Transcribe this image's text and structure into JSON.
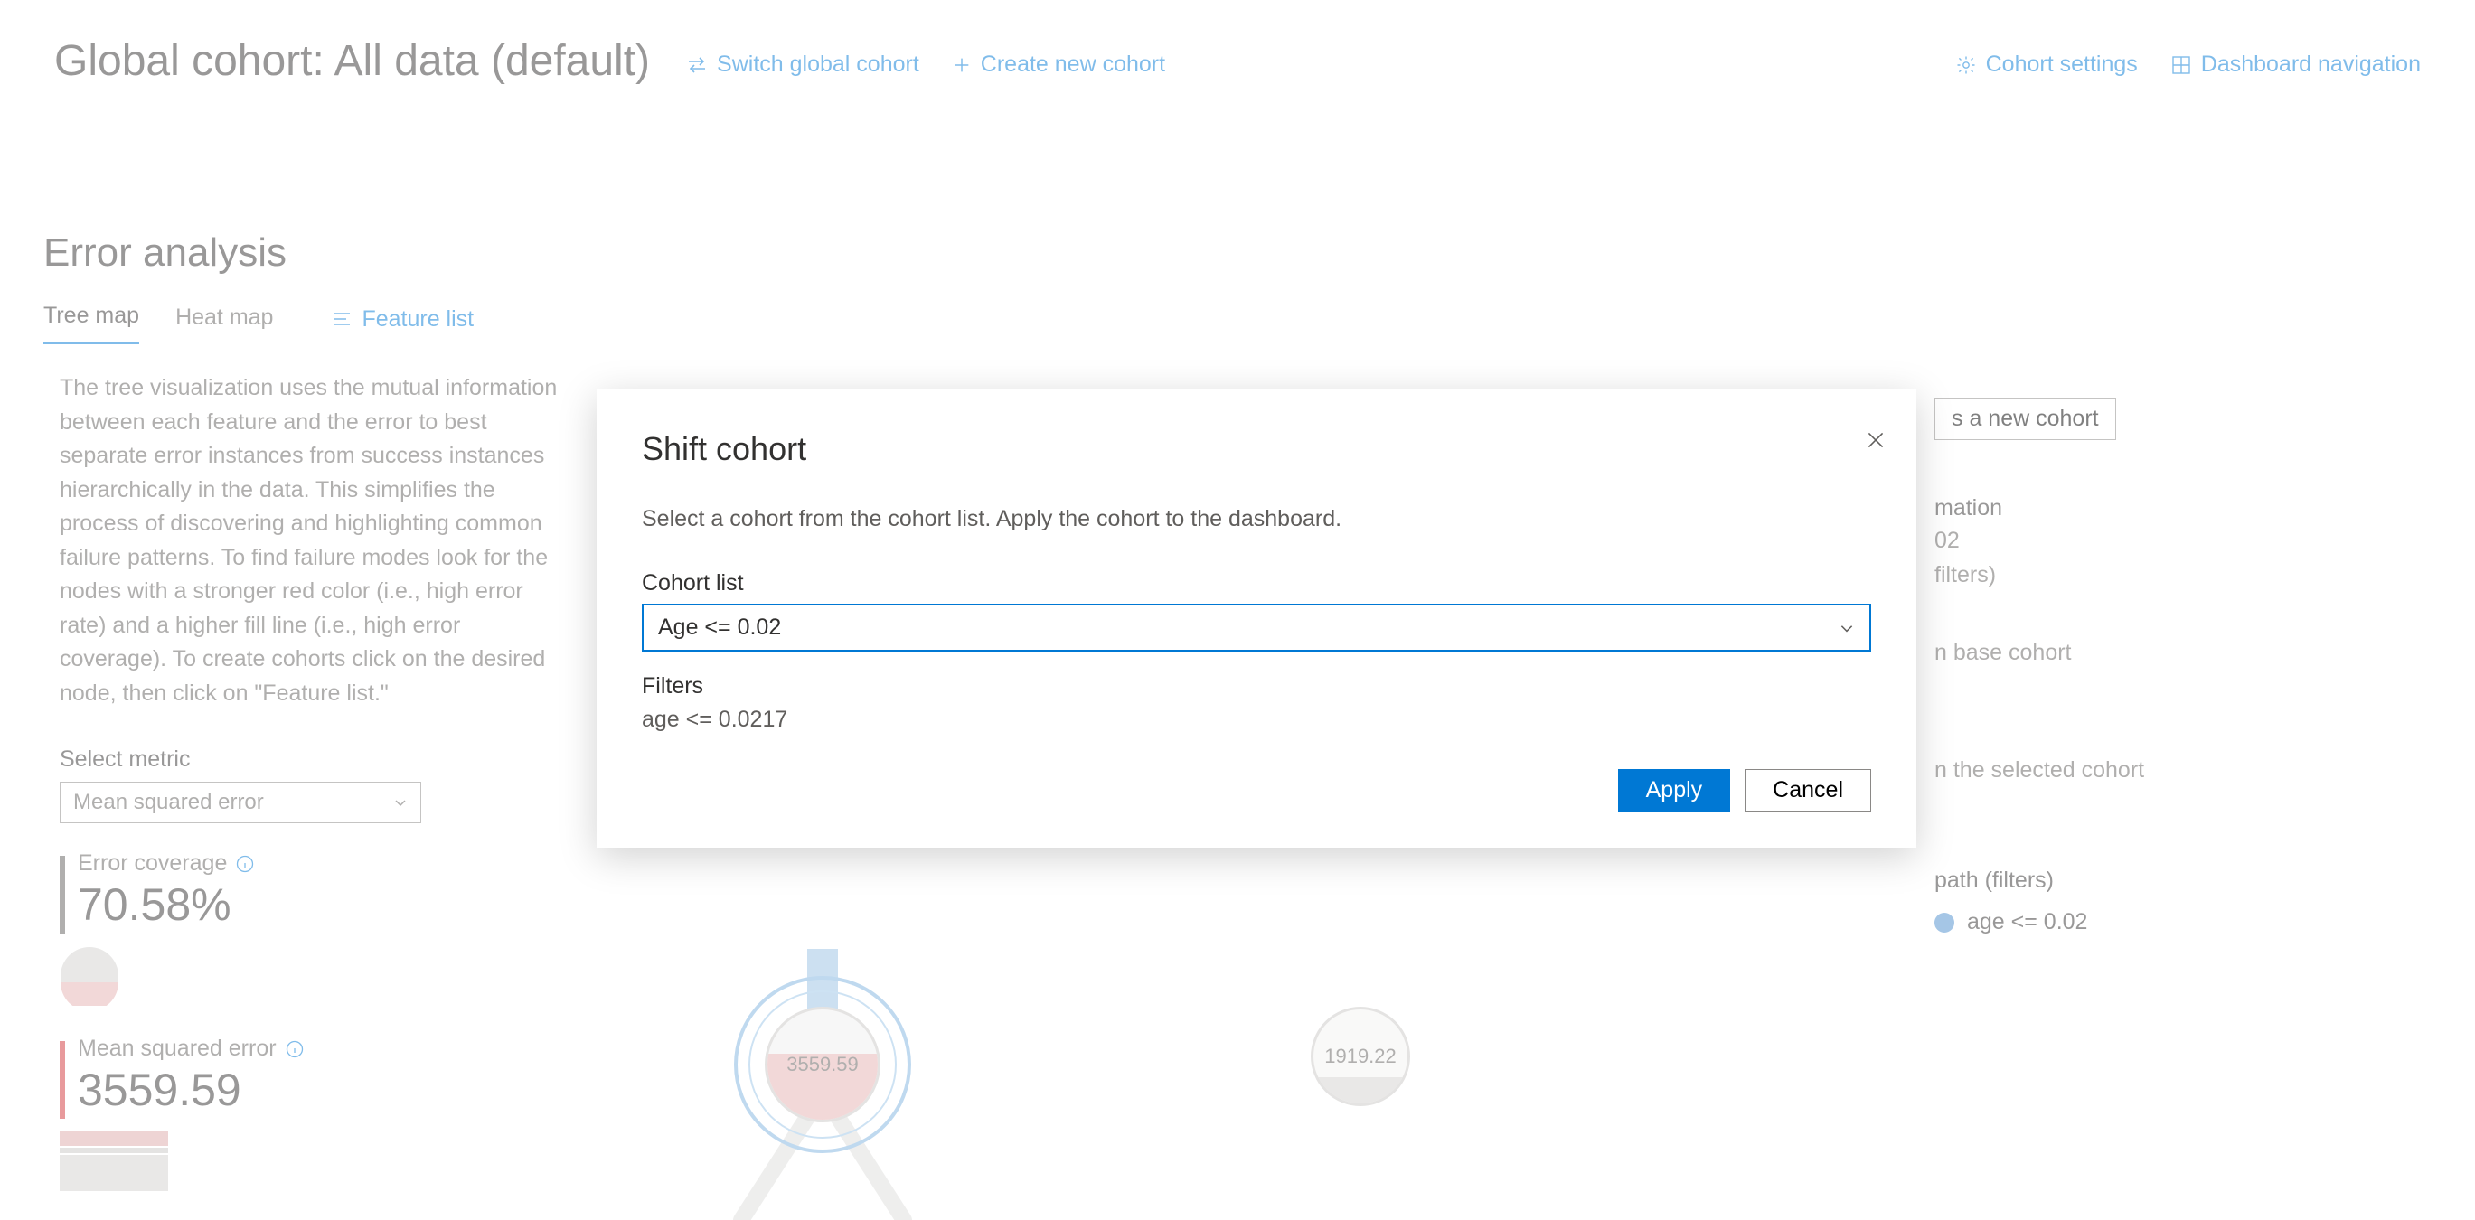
{
  "header": {
    "cohort_title": "Global cohort: All data (default)",
    "switch_label": "Switch global cohort",
    "create_label": "Create new cohort",
    "settings_label": "Cohort settings",
    "nav_label": "Dashboard navigation"
  },
  "section": {
    "title": "Error analysis",
    "tabs": {
      "tree": "Tree map",
      "heat": "Heat map"
    },
    "feature_list": "Feature list",
    "description": "The tree visualization uses the mutual information between each feature and the error to best separate error instances from success instances hierarchically in the data. This simplifies the process of discovering and highlighting common failure patterns. To find failure modes look for the nodes with a stronger red color (i.e., high error rate) and a higher fill line (i.e., high error coverage). To create cohorts click on the desired node, then click on \"Feature list.\""
  },
  "metric": {
    "label": "Select metric",
    "selected": "Mean squared error"
  },
  "stats": {
    "coverage_label": "Error coverage",
    "coverage_value": "70.58%",
    "mse_label": "Mean squared error",
    "mse_value": "3559.59"
  },
  "tree": {
    "node_left_value": "3559.59",
    "node_right_value": "1919.22"
  },
  "side": {
    "new_cohort_btn": "s a new cohort",
    "info_title": "mation",
    "info_line1": "02",
    "info_line2": "filters)",
    "base_cohort": "n base cohort",
    "selected_cohort": "n the selected cohort",
    "path_title": "path (filters)",
    "path_filter": "age <= 0.02"
  },
  "modal": {
    "title": "Shift cohort",
    "description": "Select a cohort from the cohort list. Apply the cohort to the dashboard.",
    "cohort_list_label": "Cohort list",
    "cohort_selected": "Age <= 0.02",
    "filters_label": "Filters",
    "filters_value": "age <= 0.0217",
    "apply": "Apply",
    "cancel": "Cancel"
  },
  "colors": {
    "accent": "#0078d4",
    "error_red": "#d13438",
    "error_fill": "#e4b0b0"
  }
}
